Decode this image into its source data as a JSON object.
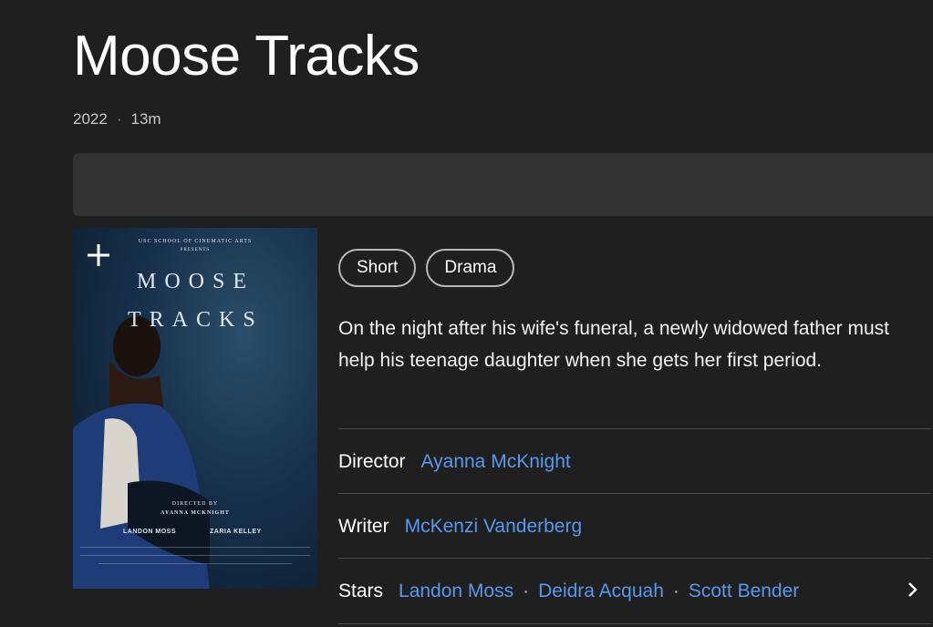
{
  "title": "Moose Tracks",
  "meta": {
    "year": "2022",
    "separator": "·",
    "runtime": "13m"
  },
  "poster": {
    "school": "USC SCHOOL OF CINEMATIC ARTS",
    "presents": "PRESENTS",
    "title_line1": "MOOSE",
    "title_line2": "TRACKS",
    "directed_by": "DIRECTED BY",
    "director": "AYANNA MCKNIGHT",
    "actor1": "LANDON MOSS",
    "actor2": "ZARIA KELLEY",
    "add_icon": "plus-icon"
  },
  "genres": [
    "Short",
    "Drama"
  ],
  "plot": "On the night after his wife's funeral, a newly widowed father must help his teenage daughter when she gets her first period.",
  "credits": {
    "director_label": "Director",
    "director": "Ayanna McKnight",
    "writer_label": "Writer",
    "writer": "McKenzi Vanderberg",
    "stars_label": "Stars",
    "stars": [
      "Landon Moss",
      "Deidra Acquah",
      "Scott Bender"
    ],
    "separator": "·",
    "more_icon": "chevron-right-icon"
  },
  "colors": {
    "background": "#1f1f1f",
    "link": "#5799ef",
    "media_bar": "#333333"
  }
}
